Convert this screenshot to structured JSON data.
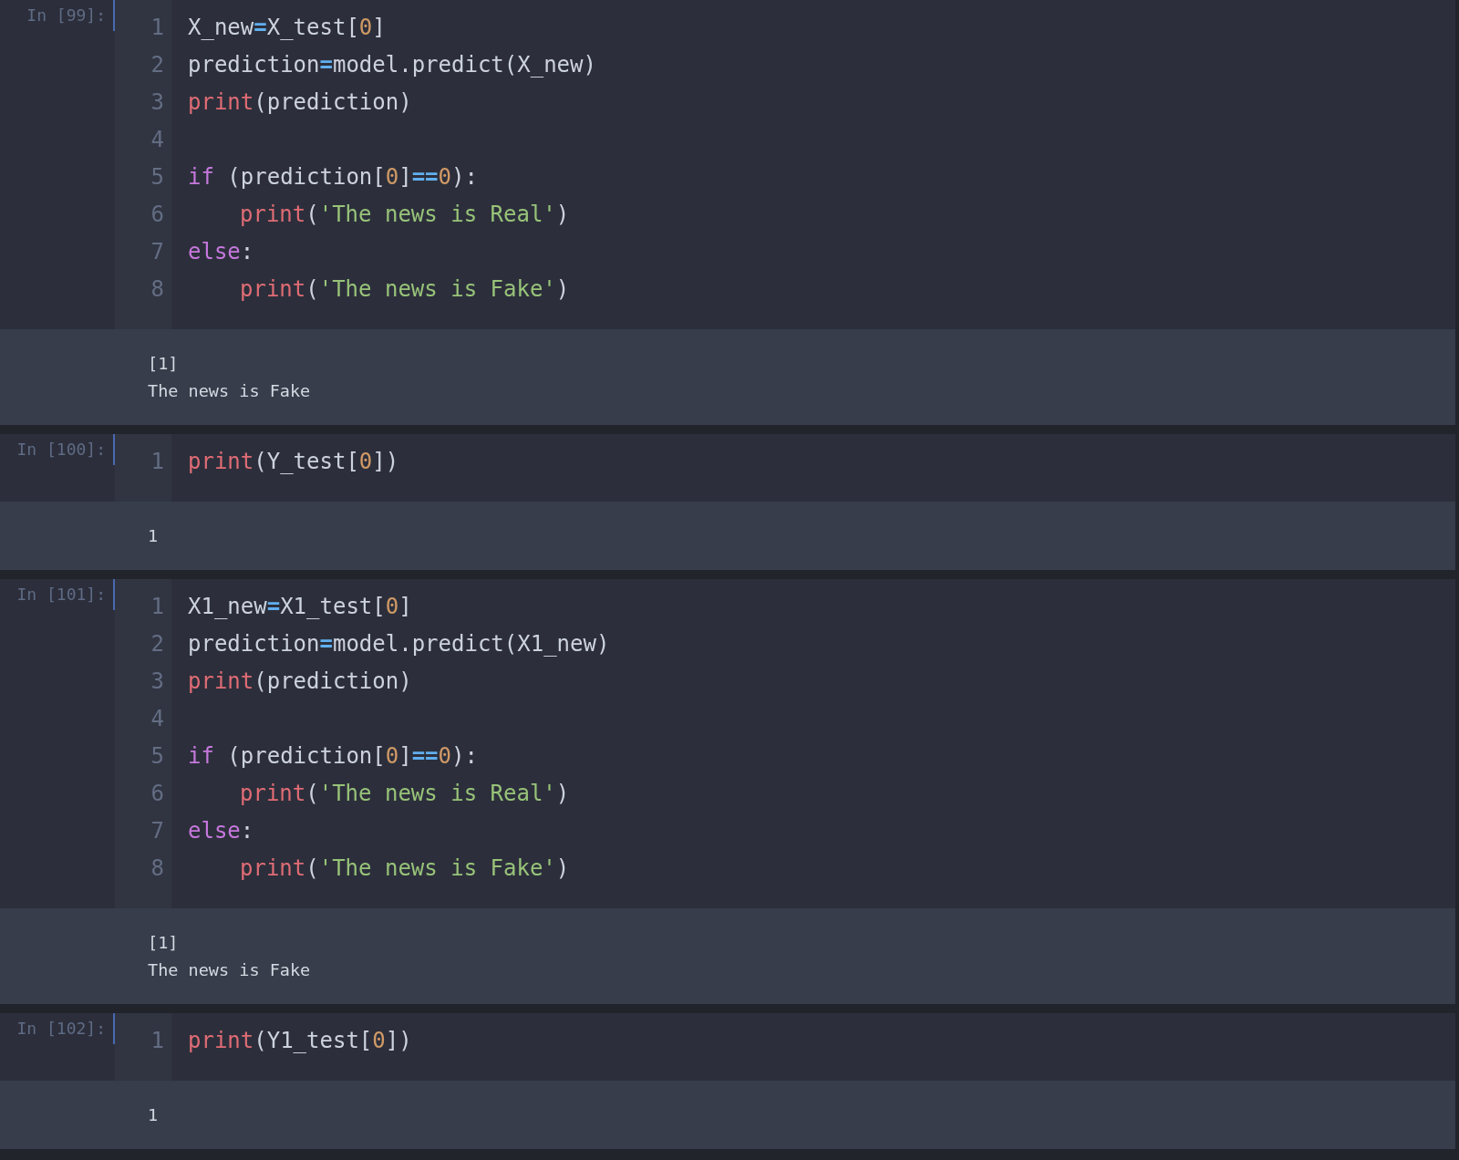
{
  "cells": [
    {
      "prompt": "In [99]:",
      "lines": [
        {
          "number": "1",
          "tokens": [
            {
              "kind": "plain",
              "text": "X_new"
            },
            {
              "kind": "operator",
              "text": "="
            },
            {
              "kind": "plain",
              "text": "X_test["
            },
            {
              "kind": "number",
              "text": "0"
            },
            {
              "kind": "plain",
              "text": "]"
            }
          ]
        },
        {
          "number": "2",
          "tokens": [
            {
              "kind": "plain",
              "text": "prediction"
            },
            {
              "kind": "operator",
              "text": "="
            },
            {
              "kind": "plain",
              "text": "model.predict(X_new)"
            }
          ]
        },
        {
          "number": "3",
          "tokens": [
            {
              "kind": "builtin",
              "text": "print"
            },
            {
              "kind": "plain",
              "text": "(prediction)"
            }
          ]
        },
        {
          "number": "4"
        },
        {
          "number": "5",
          "tokens": [
            {
              "kind": "keyword",
              "text": "if"
            },
            {
              "kind": "plain",
              "text": " (prediction["
            },
            {
              "kind": "number",
              "text": "0"
            },
            {
              "kind": "plain",
              "text": "]"
            },
            {
              "kind": "operator",
              "text": "=="
            },
            {
              "kind": "number",
              "text": "0"
            },
            {
              "kind": "plain",
              "text": "):"
            }
          ]
        },
        {
          "number": "6",
          "indented": true,
          "tokens": [
            {
              "kind": "builtin",
              "text": "print"
            },
            {
              "kind": "plain",
              "text": "("
            },
            {
              "kind": "string",
              "text": "'The news is Real'"
            },
            {
              "kind": "plain",
              "text": ")"
            }
          ]
        },
        {
          "number": "7",
          "tokens": [
            {
              "kind": "keyword",
              "text": "else"
            },
            {
              "kind": "plain",
              "text": ":"
            }
          ]
        },
        {
          "number": "8",
          "indented": true,
          "tokens": [
            {
              "kind": "builtin",
              "text": "print"
            },
            {
              "kind": "plain",
              "text": "("
            },
            {
              "kind": "string",
              "text": "'The news is Fake'"
            },
            {
              "kind": "plain",
              "text": ")"
            }
          ]
        }
      ],
      "output": [
        "[1]",
        "The news is Fake"
      ]
    },
    {
      "prompt": "In [100]:",
      "lines": [
        {
          "number": "1",
          "tokens": [
            {
              "kind": "builtin",
              "text": "print"
            },
            {
              "kind": "plain",
              "text": "(Y_test["
            },
            {
              "kind": "number",
              "text": "0"
            },
            {
              "kind": "plain",
              "text": "])"
            }
          ]
        }
      ],
      "output": [
        "1"
      ]
    },
    {
      "prompt": "In [101]:",
      "lines": [
        {
          "number": "1",
          "tokens": [
            {
              "kind": "plain",
              "text": "X1_new"
            },
            {
              "kind": "operator",
              "text": "="
            },
            {
              "kind": "plain",
              "text": "X1_test["
            },
            {
              "kind": "number",
              "text": "0"
            },
            {
              "kind": "plain",
              "text": "]"
            }
          ]
        },
        {
          "number": "2",
          "tokens": [
            {
              "kind": "plain",
              "text": "prediction"
            },
            {
              "kind": "operator",
              "text": "="
            },
            {
              "kind": "plain",
              "text": "model.predict(X1_new)"
            }
          ]
        },
        {
          "number": "3",
          "tokens": [
            {
              "kind": "builtin",
              "text": "print"
            },
            {
              "kind": "plain",
              "text": "(prediction)"
            }
          ]
        },
        {
          "number": "4"
        },
        {
          "number": "5",
          "tokens": [
            {
              "kind": "keyword",
              "text": "if"
            },
            {
              "kind": "plain",
              "text": " (prediction["
            },
            {
              "kind": "number",
              "text": "0"
            },
            {
              "kind": "plain",
              "text": "]"
            },
            {
              "kind": "operator",
              "text": "=="
            },
            {
              "kind": "number",
              "text": "0"
            },
            {
              "kind": "plain",
              "text": "):"
            }
          ]
        },
        {
          "number": "6",
          "indented": true,
          "tokens": [
            {
              "kind": "builtin",
              "text": "print"
            },
            {
              "kind": "plain",
              "text": "("
            },
            {
              "kind": "string",
              "text": "'The news is Real'"
            },
            {
              "kind": "plain",
              "text": ")"
            }
          ]
        },
        {
          "number": "7",
          "tokens": [
            {
              "kind": "keyword",
              "text": "else"
            },
            {
              "kind": "plain",
              "text": ":"
            }
          ]
        },
        {
          "number": "8",
          "indented": true,
          "tokens": [
            {
              "kind": "builtin",
              "text": "print"
            },
            {
              "kind": "plain",
              "text": "("
            },
            {
              "kind": "string",
              "text": "'The news is Fake'"
            },
            {
              "kind": "plain",
              "text": ")"
            }
          ]
        }
      ],
      "output": [
        "[1]",
        "The news is Fake"
      ]
    },
    {
      "prompt": "In [102]:",
      "lines": [
        {
          "number": "1",
          "tokens": [
            {
              "kind": "builtin",
              "text": "print"
            },
            {
              "kind": "plain",
              "text": "(Y1_test["
            },
            {
              "kind": "number",
              "text": "0"
            },
            {
              "kind": "plain",
              "text": "])"
            }
          ]
        }
      ],
      "output": [
        "1"
      ]
    }
  ]
}
